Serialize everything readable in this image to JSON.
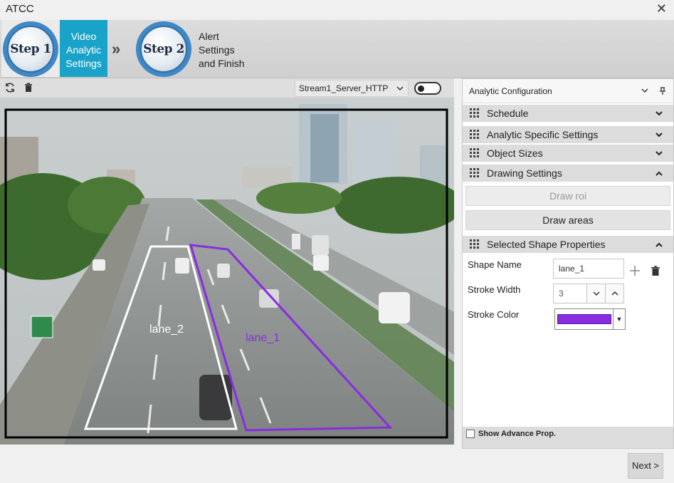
{
  "window": {
    "title": "ATCC",
    "close_glyph": "✕"
  },
  "steps": [
    {
      "badge": "Step 1",
      "label_lines": [
        "Video",
        "Analytic",
        "Settings"
      ],
      "active": true
    },
    {
      "badge": "Step 2",
      "label_lines": [
        "Alert",
        "Settings",
        "and Finish"
      ],
      "active": false
    }
  ],
  "step_separator": "»",
  "video_toolbar": {
    "refresh_icon": "refresh-icon",
    "delete_icon": "trash-icon",
    "stream_selected": "Stream1_Server_HTTP",
    "toggle_on": false
  },
  "video": {
    "shapes": [
      {
        "name": "lane_2",
        "color": "#ffffff"
      },
      {
        "name": "lane_1",
        "color": "#8a2be2"
      }
    ]
  },
  "panel": {
    "title": "Analytic Configuration",
    "sections": [
      {
        "label": "Schedule",
        "expanded": false
      },
      {
        "label": "Analytic Specific Settings",
        "expanded": false
      },
      {
        "label": "Object Sizes",
        "expanded": false
      },
      {
        "label": "Drawing Settings",
        "expanded": true
      }
    ],
    "draw_roi_label": "Draw roi",
    "draw_areas_label": "Draw areas",
    "shape_props_title": "Selected Shape Properties",
    "shape_name_label": "Shape Name",
    "shape_name_value": "lane_1",
    "stroke_width_label": "Stroke Width",
    "stroke_width_value": "3",
    "stroke_color_label": "Stroke Color",
    "stroke_color_value": "#8a2be2",
    "advance_label": "Show Advance Prop."
  },
  "footer": {
    "next_label": "Next >"
  },
  "colors": {
    "accent": "#1aa3c9",
    "step_ring": "#3f88c5",
    "shape_purple": "#8a2be2"
  }
}
